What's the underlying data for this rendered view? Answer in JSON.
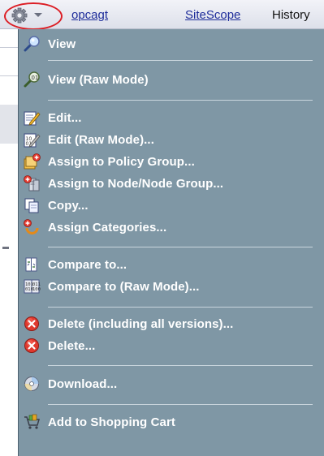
{
  "header": {
    "tabs": [
      {
        "label": "opcagt"
      },
      {
        "label": "SiteScope"
      },
      {
        "label": "History"
      }
    ]
  },
  "menu": {
    "items": [
      {
        "label": "View",
        "icon": "magnifier-icon"
      },
      {
        "label": "View (Raw Mode)",
        "icon": "magnifier-raw-icon"
      },
      {
        "label": "Edit...",
        "icon": "edit-icon"
      },
      {
        "label": "Edit (Raw Mode)...",
        "icon": "edit-raw-icon"
      },
      {
        "label": "Assign to Policy Group...",
        "icon": "assign-policy-group-icon"
      },
      {
        "label": "Assign to Node/Node Group...",
        "icon": "assign-node-icon"
      },
      {
        "label": "Copy...",
        "icon": "copy-icon"
      },
      {
        "label": "Assign Categories...",
        "icon": "assign-categories-icon"
      },
      {
        "label": "Compare to...",
        "icon": "compare-icon"
      },
      {
        "label": "Compare to (Raw Mode)...",
        "icon": "compare-raw-icon"
      },
      {
        "label": "Delete (including all versions)...",
        "icon": "delete-all-icon"
      },
      {
        "label": "Delete...",
        "icon": "delete-icon"
      },
      {
        "label": "Download...",
        "icon": "download-disc-icon"
      },
      {
        "label": "Add to Shopping Cart",
        "icon": "shopping-cart-icon"
      }
    ]
  },
  "colors": {
    "menu_background": "#7f97a5",
    "menu_text": "#ffffff",
    "link": "#1d2c9a",
    "highlight_circle": "#dc1f26"
  }
}
